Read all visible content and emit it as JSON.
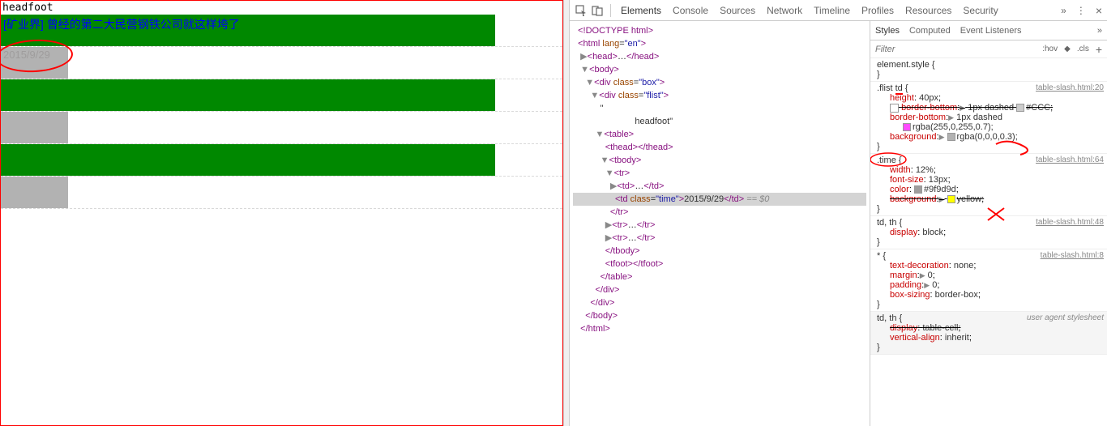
{
  "page": {
    "headfoot": "headfoot",
    "category": "[矿业界]",
    "article_title": "曾经的第二大民营钢铁公司就这样垮了",
    "time_value": "2015/9/29"
  },
  "devtools": {
    "tabs": [
      "Elements",
      "Console",
      "Sources",
      "Network",
      "Timeline",
      "Profiles",
      "Resources",
      "Security"
    ],
    "active_tab": "Elements",
    "dom": {
      "doctype": "<!DOCTYPE html>",
      "html_open": "<html lang=\"en\">",
      "head": "<head>…</head>",
      "body_open": "<body>",
      "div_box": "<div class=\"box\">",
      "div_flist": "<div class=\"flist\">",
      "text_headfoot": "\"\n                            headfoot\"",
      "table_open": "<table>",
      "thead": "<thead></thead>",
      "tbody_open": "<tbody>",
      "tr_open": "<tr>",
      "td1": "<td>…</td>",
      "td_time_open": "<td class=\"time\">",
      "td_time_text": "2015/9/29",
      "td_time_close": "</td>",
      "td_eq": " == $0",
      "tr_close": "</tr>",
      "tr_more1": "<tr>…</tr>",
      "tr_more2": "<tr>…</tr>",
      "tbody_close": "</tbody>",
      "tfoot": "<tfoot></tfoot>",
      "table_close": "</table>",
      "div_close": "</div>",
      "body_close": "</body>",
      "html_close": "</html>"
    },
    "styles": {
      "tabs": [
        "Styles",
        "Computed",
        "Event Listeners"
      ],
      "active_tab": "Styles",
      "filter_placeholder": "Filter",
      "hov": ":hov",
      "cls": ".cls",
      "source_file": "table-slash.html",
      "rules": {
        "element_style": "element.style {",
        "flist_td_sel": ".flist td {",
        "flist_td_link": "table-slash.html:20",
        "flist_td_height": "height: 40px;",
        "flist_td_bb_struck": "border-bottom:▶ 1px dashed ▢#CCC;",
        "flist_td_bb": "border-bottom:▶ 1px dashed",
        "flist_td_bb_color": "rgba(255,0,255,0.7);",
        "flist_td_bg": "background:▶",
        "flist_td_bg_val": "rgba(0,0,0,0.3);",
        "time_sel": ".time {",
        "time_link": "table-slash.html:64",
        "time_width": "width: 12%;",
        "time_fs": "font-size: 13px;",
        "time_color": "color: ▢#9f9d9d;",
        "time_bg_struck": "background:▶ ▢yellow;",
        "tdth_sel": "td, th {",
        "tdth_link": "table-slash.html:48",
        "tdth_display": "display: block;",
        "star_sel": "* {",
        "star_link": "table-slash.html:8",
        "star_td": "text-decoration: none;",
        "star_mg": "margin:▶ 0;",
        "star_pd": "padding:▶ 0;",
        "star_bs": "box-sizing: border-box;",
        "ua_tdth_sel": "td, th {",
        "ua_label": "user agent stylesheet",
        "ua_display": "display: table-cell;",
        "ua_va": "vertical-align: inherit;"
      }
    }
  }
}
